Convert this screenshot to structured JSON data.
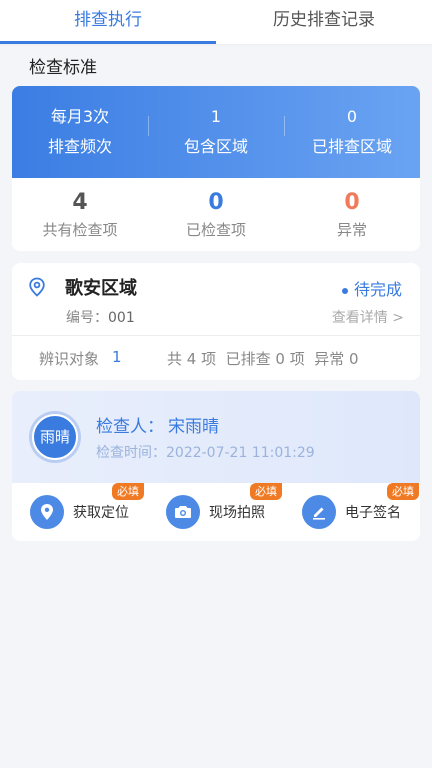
{
  "tabs": [
    {
      "label": "排查执行",
      "active": true
    },
    {
      "label": "历史排查记录",
      "active": false
    }
  ],
  "section_title": "检查标准",
  "stats_top": [
    {
      "value": "每月3次",
      "label": "排查频次"
    },
    {
      "value": "1",
      "label": "包含区域"
    },
    {
      "value": "0",
      "label": "已排查区域"
    }
  ],
  "stats_bottom": [
    {
      "value": "4",
      "label": "共有检查项",
      "color": "#555555"
    },
    {
      "value": "0",
      "label": "已检查项",
      "color": "#3a7be0"
    },
    {
      "value": "0",
      "label": "异常",
      "color": "#f07a5a"
    }
  ],
  "area": {
    "name": "歌安区域",
    "status": "待完成",
    "code_label": "编号：",
    "code": "001",
    "detail_link": "查看详情 >",
    "object_label": "辨识对象",
    "object_count": "1",
    "summary": "共 4 项  已排查 0 项  异常 0"
  },
  "inspector": {
    "avatar_text": "雨晴",
    "label": "检查人：",
    "name": "宋雨晴",
    "time_label": "检查时间：",
    "time": "2022-07-21 11:01:29"
  },
  "actions": [
    {
      "label": "获取定位",
      "badge": "必填",
      "icon": "location-icon"
    },
    {
      "label": "现场拍照",
      "badge": "必填",
      "icon": "camera-icon"
    },
    {
      "label": "电子签名",
      "badge": "必填",
      "icon": "pen-icon"
    }
  ],
  "colors": {
    "accent": "#3a7be0",
    "badge": "#f07a24",
    "abnormal": "#f07a5a"
  }
}
